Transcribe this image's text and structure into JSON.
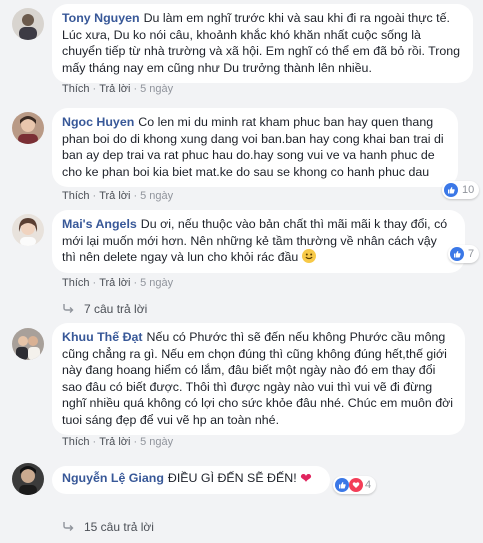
{
  "comments": [
    {
      "author": "Tony Nguyen",
      "text": "Du làm em nghĩ trước khi và sau khi đi ra ngoài thực tế. Lúc xưa, Du ko nói câu, khoảnh khắc khó khăn nhất cuộc sống là chuyển tiếp từ nhà trường và xã hội. Em nghĩ có thể em đã bỏ rồi. Trong mấy tháng nay em cũng như Du trưởng thành lên nhiều.",
      "like": "Thích",
      "reply": "Trả lời",
      "time": "5 ngày"
    },
    {
      "author": "Ngoc Huyen",
      "text": "Co len mi du minh rat kham phuc ban hay quen thang phan boi do di khong xung dang voi ban.ban hay cong khai ban trai di ban ay dep trai va rat phuc hau do.hay song vui ve va hanh phuc de cho ke phan boi kia biet mat.ke do sau se khong co hanh phuc dau",
      "like": "Thích",
      "reply": "Trả lời",
      "time": "5 ngày",
      "reaction_count": "10"
    },
    {
      "author": "Mai's Angels",
      "text": "Du ơi, nếu thuộc vào bản chất thì mãi mãi k thay đổi, có mới lại muốn mới hơn. Nên những kẻ tầm thường về nhân cách vậy thì nên delete ngay và lun cho khỏi rác đầu",
      "like": "Thích",
      "reply": "Trả lời",
      "time": "5 ngày",
      "reaction_count": "7",
      "replies_label": "7 câu trả lời"
    },
    {
      "author": "Khuu Thế Đạt",
      "text": "Nếu có Phước thì sẽ đến nếu không Phước cầu mông cũng chẳng ra gì. Nếu em chọn đúng thì cũng không đúng hết,thế giới này đang hoang hiểm có lắm, đâu biết một ngày nào đó em thay đổi sao đâu có biết được. Thôi thì được ngày nào vui thì vui vẽ đi đừng nghĩ nhiều quá không có lợi cho sức khỏe đâu nhé. Chúc em muôn đời tuoi sáng đẹp để vui vẽ hp an toàn nhé.",
      "like": "Thích",
      "reply": "Trả lời",
      "time": "5 ngày"
    },
    {
      "author": "Nguyễn Lệ Giang",
      "text": "ĐIỀU GÌ ĐẾN SẼ ĐẾN!",
      "reaction_count": "4",
      "replies_label": "15 câu trả lời"
    }
  ],
  "colors": {
    "author": "#385898",
    "like": "#3b78e7",
    "love": "#f33e58",
    "background": "#f2f3f5"
  },
  "icons": [
    "avatar",
    "like-icon",
    "heart-icon",
    "smile-emoji-icon",
    "reply-arrow-icon"
  ]
}
